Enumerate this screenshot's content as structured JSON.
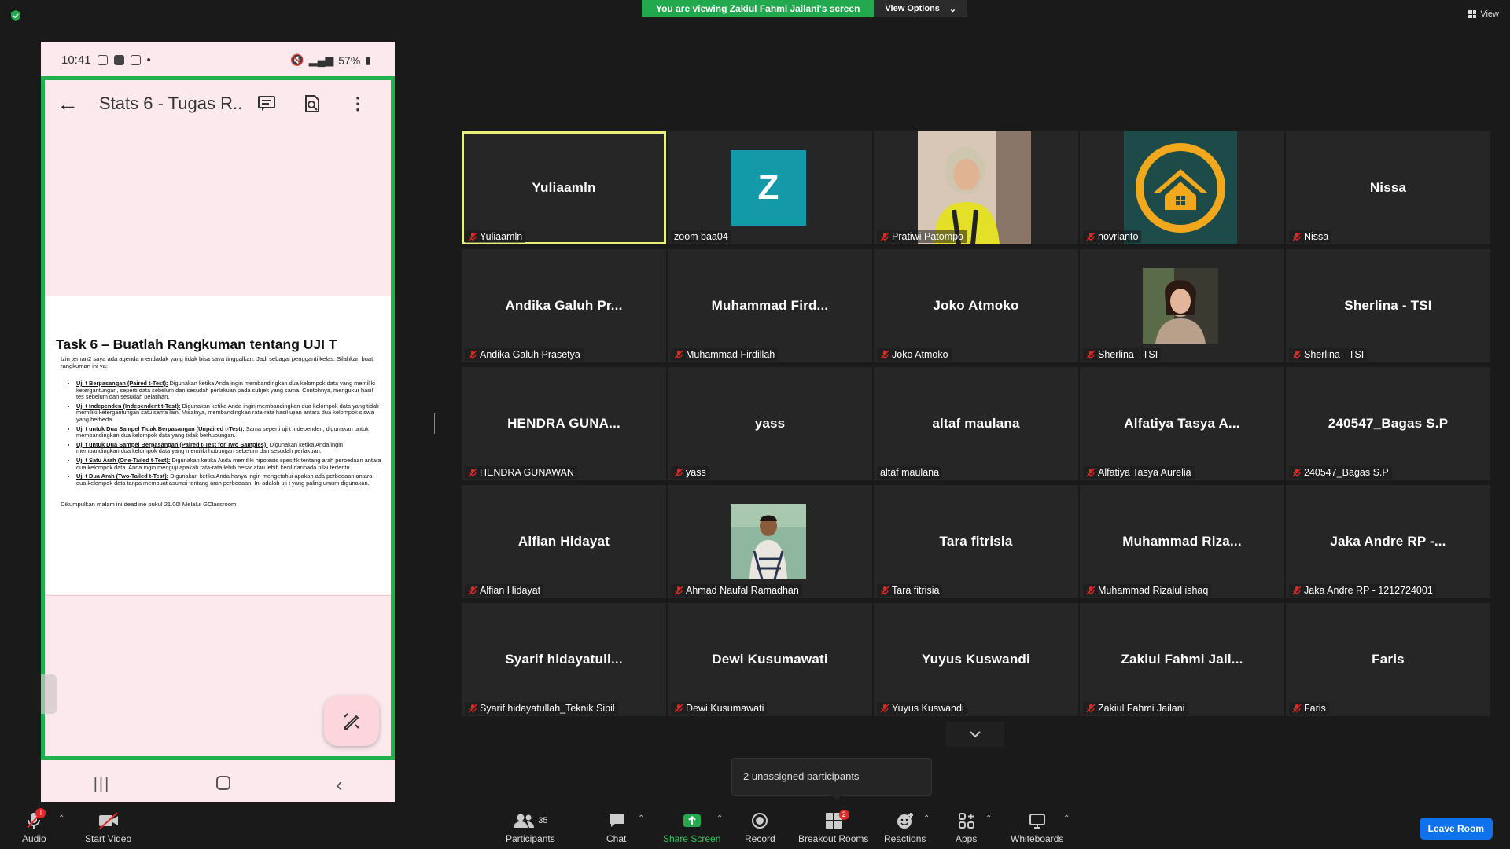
{
  "banner": {
    "text": "You are viewing Zakiul Fahmi Jailani's screen",
    "options_label": "View Options"
  },
  "view_label": "View",
  "phone": {
    "time": "10:41",
    "battery": "57%",
    "doc_title": "Stats 6 - Tugas R...",
    "task_heading": "Task 6 – Buatlah Rangkuman tentang UJI T",
    "intro": "Izin teman2 saya ada agenda mendadak yang tidak bisa saya tinggalkan. Jadi sebagai pengganti kelas. Silahkan buat rangkuman ini ya:",
    "items": [
      {
        "term": "Uji t Berpasangan (Paired t-Test):",
        "desc": " Digunakan ketika Anda ingin membandingkan dua kelompok data yang memiliki ketergantungan, seperti data sebelum dan sesudah perlakuan pada subjek yang sama. Contohnya, mengukur hasil tes sebelum dan sesudah pelatihan."
      },
      {
        "term": "Uji t Independen (Independent t-Test):",
        "desc": " Digunakan ketika Anda ingin membandingkan dua kelompok data yang tidak memiliki ketergantungan satu sama lain. Misalnya, membandingkan rata-rata hasil ujian antara dua kelompok siswa yang berbeda."
      },
      {
        "term": "Uji t untuk Dua Sampel Tidak Berpasangan (Unpaired t-Test):",
        "desc": " Sama seperti uji t independen, digunakan untuk membandingkan dua kelompok data yang tidak berhubungan."
      },
      {
        "term": "Uji t untuk Dua Sampel Berpasangan (Paired t-Test for Two Samples):",
        "desc": " Digunakan ketika Anda ingin membandingkan dua kelompok data yang memiliki hubungan sebelum dan sesudah perlakuan."
      },
      {
        "term": "Uji t Satu Arah (One-Tailed t-Test):",
        "desc": " Digunakan ketika Anda memiliki hipotesis spesifik tentang arah perbedaan antara dua kelompok data. Anda ingin menguji apakah rata-rata lebih besar atau lebih kecil daripada nilai tertentu."
      },
      {
        "term": "Uji t Dua Arah (Two-Tailed t-Test):",
        "desc": " Digunakan ketika Anda hanya ingin mengetahui apakah ada perbedaan antara dua kelompok data tanpa membuat asumsi tentang arah perbedaan. Ini adalah uji t yang paling umum digunakan."
      }
    ],
    "footer": "Dikumpulkan malam ini deadline pukul 21.00! Melalui GClassroom"
  },
  "participants": [
    {
      "name": "Yuliaamln",
      "label": "Yuliaamln",
      "kind": "name",
      "muted": true,
      "active": true
    },
    {
      "name": "",
      "label": "zoom baa04",
      "kind": "avatar-z",
      "avatar_letter": "Z",
      "muted": false
    },
    {
      "name": "",
      "label": "Pratiwi Patompo",
      "kind": "photo-woman",
      "muted": true
    },
    {
      "name": "",
      "label": "novrianto",
      "kind": "logo",
      "muted": true
    },
    {
      "name": "Nissa",
      "label": "Nissa",
      "kind": "name",
      "muted": true
    },
    {
      "name": "Andika  Galuh  Pr...",
      "label": "Andika Galuh Prasetya",
      "kind": "name",
      "muted": true
    },
    {
      "name": "Muhammad  Fird...",
      "label": "Muhammad Firdillah",
      "kind": "name",
      "muted": true
    },
    {
      "name": "Joko Atmoko",
      "label": "Joko Atmoko",
      "kind": "name",
      "muted": true
    },
    {
      "name": "",
      "label": "Sherlina - TSI",
      "kind": "photo-girl",
      "muted": true
    },
    {
      "name": "Sherlina - TSI",
      "label": "Sherlina - TSI",
      "kind": "name",
      "muted": true
    },
    {
      "name": "HENDRA  GUNA...",
      "label": "HENDRA GUNAWAN",
      "kind": "name",
      "muted": true
    },
    {
      "name": "yass",
      "label": "yass",
      "kind": "name",
      "muted": true
    },
    {
      "name": "altaf maulana",
      "label": "altaf maulana",
      "kind": "name",
      "muted": false
    },
    {
      "name": "Alfatiya  Tasya  A...",
      "label": "Alfatiya Tasya Aurelia",
      "kind": "name",
      "muted": true
    },
    {
      "name": "240547_Bagas S.P",
      "label": "240547_Bagas S.P",
      "kind": "name",
      "muted": true
    },
    {
      "name": "Alfian Hidayat",
      "label": "Alfian Hidayat",
      "kind": "name",
      "muted": true
    },
    {
      "name": "",
      "label": "Ahmad Naufal Ramadhan",
      "kind": "photo-man",
      "muted": true
    },
    {
      "name": "Tara fitrisia",
      "label": "Tara fitrisia",
      "kind": "name",
      "muted": true
    },
    {
      "name": "Muhammad  Riza...",
      "label": "Muhammad Rizalul ishaq",
      "kind": "name",
      "muted": true
    },
    {
      "name": "Jaka Andre RP -...",
      "label": "Jaka Andre RP - 1212724001",
      "kind": "name",
      "muted": true
    },
    {
      "name": "Syarif  hidayatull...",
      "label": "Syarif hidayatullah_Teknik Sipil",
      "kind": "name",
      "muted": true
    },
    {
      "name": "Dewi Kusumawati",
      "label": "Dewi Kusumawati",
      "kind": "name",
      "muted": true
    },
    {
      "name": "Yuyus Kuswandi",
      "label": "Yuyus Kuswandi",
      "kind": "name",
      "muted": true
    },
    {
      "name": "Zakiul  Fahmi  Jail...",
      "label": "Zakiul Fahmi Jailani",
      "kind": "name",
      "muted": true
    },
    {
      "name": "Faris",
      "label": "Faris",
      "kind": "name",
      "muted": true
    }
  ],
  "tooltip": "2 unassigned participants",
  "toolbar": {
    "audio": "Audio",
    "audio_badge": "!",
    "start_video": "Start Video",
    "participants": "Participants",
    "participants_count": "35",
    "chat": "Chat",
    "share_screen": "Share Screen",
    "record": "Record",
    "breakout_rooms": "Breakout Rooms",
    "breakout_badge": "2",
    "reactions": "Reactions",
    "apps": "Apps",
    "whiteboards": "Whiteboards",
    "leave": "Leave Room"
  },
  "colors": {
    "share_green": "#23a94d",
    "active_border": "#e8f079",
    "leave_blue": "#0e72ed",
    "mute_red": "#e02828"
  }
}
